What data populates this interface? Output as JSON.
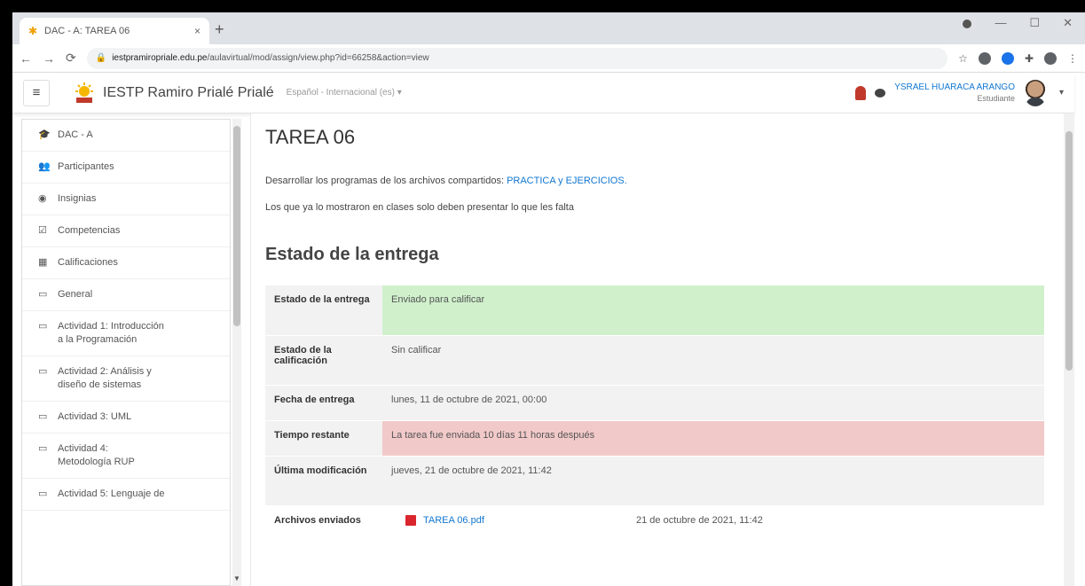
{
  "browser": {
    "tab_title": "DAC - A: TAREA 06",
    "tab_close": "×",
    "new_tab": "+",
    "url_host": "iestpramiropriale.edu.pe",
    "url_path": "/aulavirtual/mod/assign/view.php?id=66258&action=view",
    "minimize": "—",
    "maximize": "☐",
    "close": "✕"
  },
  "navbar": {
    "site_name": "IESTP Ramiro Prialé Prialé",
    "language": "Español - Internacional (es) ▾",
    "user_name": "YSRAEL HUARACA ARANGO",
    "user_role": "Estudiante"
  },
  "sidebar": {
    "items": [
      {
        "icon": "mortarboard-icon",
        "glyph": "🎓",
        "label": "DAC - A"
      },
      {
        "icon": "users-icon",
        "glyph": "👥",
        "label": "Participantes"
      },
      {
        "icon": "shield-icon",
        "glyph": "◉",
        "label": "Insignias"
      },
      {
        "icon": "checkbox-icon",
        "glyph": "☑",
        "label": "Competencias"
      },
      {
        "icon": "grid-icon",
        "glyph": "▦",
        "label": "Calificaciones"
      },
      {
        "icon": "folder-icon",
        "glyph": "▭",
        "label": "General"
      },
      {
        "icon": "folder-icon",
        "glyph": "▭",
        "label": "Actividad 1: Introducción a la Programación"
      },
      {
        "icon": "folder-icon",
        "glyph": "▭",
        "label": "Actividad 2: Análisis y diseño de sistemas"
      },
      {
        "icon": "folder-icon",
        "glyph": "▭",
        "label": "Actividad 3: UML"
      },
      {
        "icon": "folder-icon",
        "glyph": "▭",
        "label": "Actividad 4: Metodología RUP"
      },
      {
        "icon": "folder-icon",
        "glyph": "▭",
        "label": "Actividad 5: Lenguaje de"
      }
    ]
  },
  "main": {
    "title": "TAREA 06",
    "intro_prefix": "Desarrollar los programas de los archivos compartidos: ",
    "intro_link": "PRACTICA y EJERCICIOS.",
    "intro_line2": "Los que ya lo mostraron en clases solo deben presentar lo que les falta",
    "section_title": "Estado de la entrega",
    "status_rows": [
      {
        "label": "Estado de la entrega",
        "value": "Enviado para calificar"
      },
      {
        "label": "Estado de la calificación",
        "value": "Sin calificar"
      },
      {
        "label": "Fecha de entrega",
        "value": "lunes, 11 de octubre de 2021, 00:00"
      },
      {
        "label": "Tiempo restante",
        "value": "La tarea fue enviada 10 días 11 horas después"
      },
      {
        "label": "Última modificación",
        "value": "jueves, 21 de octubre de 2021, 11:42"
      },
      {
        "label": "Archivos enviados",
        "file_name": "TAREA 06.pdf",
        "file_date": "21 de octubre de 2021, 11:42"
      }
    ]
  },
  "colors": {
    "link": "#1177d1",
    "submitted_bg": "#d0f0cc",
    "late_bg": "#f2c9c9",
    "row_bg": "#f2f2f2"
  }
}
